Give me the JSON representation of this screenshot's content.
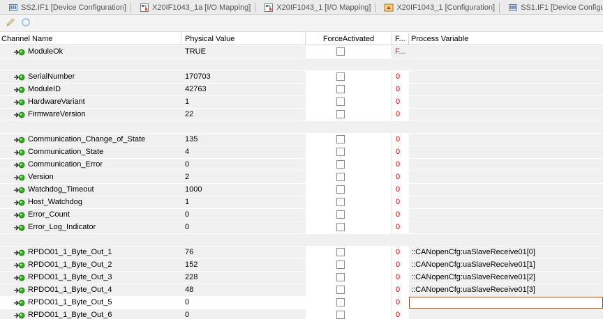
{
  "tabs": [
    {
      "label": "SS2.IF1 [Device Configuration]",
      "icon": "device-config-icon"
    },
    {
      "label": "X20IF1043_1a [I/O Mapping]",
      "icon": "io-mapping-icon"
    },
    {
      "label": "X20IF1043_1 [I/O Mapping]",
      "icon": "io-mapping-icon"
    },
    {
      "label": "X20IF1043_1 [Configuration]",
      "icon": "configuration-icon"
    },
    {
      "label": "SS1.IF1 [Device Configura",
      "icon": "device-config-icon"
    }
  ],
  "toolbar": {
    "tools": [
      {
        "icon": "pencil-icon"
      },
      {
        "icon": "refresh-icon"
      }
    ]
  },
  "grid": {
    "headers": {
      "channel_name": "Channel Name",
      "physical_value": "Physical Value",
      "force_activated": "ForceActivated",
      "force_value": "F...",
      "process_variable": "Process Variable"
    },
    "rows": [
      {
        "name": "ModuleOk",
        "value": "TRUE",
        "force": "F...",
        "pv": "",
        "force_dim": true
      },
      {
        "spacer": true
      },
      {
        "name": "SerialNumber",
        "value": "170703",
        "force": "0",
        "pv": ""
      },
      {
        "name": "ModuleID",
        "value": "42763",
        "force": "0",
        "pv": ""
      },
      {
        "name": "HardwareVariant",
        "value": "1",
        "force": "0",
        "pv": ""
      },
      {
        "name": "FirmwareVersion",
        "value": "22",
        "force": "0",
        "pv": ""
      },
      {
        "spacer": true
      },
      {
        "name": "Communication_Change_of_State",
        "value": "135",
        "force": "0",
        "pv": ""
      },
      {
        "name": "Communication_State",
        "value": "4",
        "force": "0",
        "pv": ""
      },
      {
        "name": "Communication_Error",
        "value": "0",
        "force": "0",
        "pv": ""
      },
      {
        "name": "Version",
        "value": "2",
        "force": "0",
        "pv": ""
      },
      {
        "name": "Watchdog_Timeout",
        "value": "1000",
        "force": "0",
        "pv": ""
      },
      {
        "name": "Host_Watchdog",
        "value": "1",
        "force": "0",
        "pv": ""
      },
      {
        "name": "Error_Count",
        "value": "0",
        "force": "0",
        "pv": ""
      },
      {
        "name": "Error_Log_Indicator",
        "value": "0",
        "force": "0",
        "pv": ""
      },
      {
        "spacer": true
      },
      {
        "name": "RPDO01_1_Byte_Out_1",
        "value": "76",
        "force": "0",
        "pv": "::CANopenCfg:uaSlaveReceive01[0]"
      },
      {
        "name": "RPDO01_1_Byte_Out_2",
        "value": "152",
        "force": "0",
        "pv": "::CANopenCfg:uaSlaveReceive01[1]"
      },
      {
        "name": "RPDO01_1_Byte_Out_3",
        "value": "228",
        "force": "0",
        "pv": "::CANopenCfg:uaSlaveReceive01[2]"
      },
      {
        "name": "RPDO01_1_Byte_Out_4",
        "value": "48",
        "force": "0",
        "pv": "::CANopenCfg:uaSlaveReceive01[3]"
      },
      {
        "name": "RPDO01_1_Byte_Out_5",
        "value": "0",
        "force": "0",
        "pv": "",
        "selected": true
      },
      {
        "name": "RPDO01_1_Byte_Out_6",
        "value": "0",
        "force": "0",
        "pv": ""
      }
    ]
  },
  "colors": {
    "force_value_red": "#d40000",
    "pin_green": "#2fae1e",
    "row_background": "#f0f0f0"
  }
}
